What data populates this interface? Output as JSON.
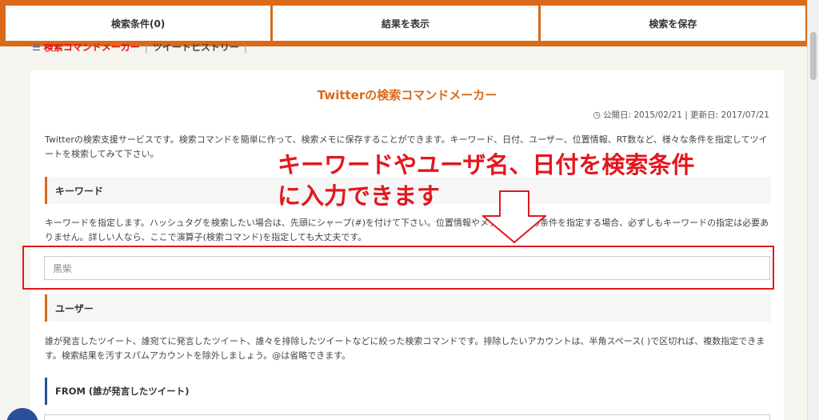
{
  "topbar": {
    "search_conditions": "検索条件(0)",
    "show_results": "結果を表示",
    "save_search": "検索を保存"
  },
  "subnav": {
    "active_tab": "検索コマンドメーカー",
    "other_tab": "ツイートヒストリー"
  },
  "page": {
    "title": "Twitterの検索コマンドメーカー",
    "dates": "公開日: 2015/02/21 | 更新日: 2017/07/21",
    "intro": "Twitterの検索支援サービスです。検索コマンドを簡単に作って、検索メモに保存することができます。キーワード、日付、ユーザー、位置情報、RT数など、様々な条件を指定してツイートを検索してみて下さい。"
  },
  "keyword_section": {
    "heading": "キーワード",
    "description": "キーワードを指定します。ハッシュタグを検索したい場合は、先頭にシャープ(#)を付けて下さい。位置情報やメディア、他の条件を指定する場合、必ずしもキーワードの指定は必要ありません。詳しい人なら、ここで演算子(検索コマンド)を指定しても大丈夫です。",
    "input_value": "黒柴"
  },
  "user_section": {
    "heading": "ユーザー",
    "description": "誰が発言したツイート、誰宛てに発言したツイート、誰々を排除したツイートなどに絞った検索コマンドです。排除したいアカウントは、半角スペース( )で区切れば、複数指定できます。検索結果を汚すスパムアカウントを除外しましょう。@は省略できます。",
    "from_heading": "FROM (誰が発言したツイート)"
  },
  "annotation": {
    "line1": "キーワードやユーザ名、日付を検索条件",
    "line2": "に入力できます"
  },
  "colors": {
    "accent_orange": "#d96a1a",
    "annotation_red": "#e3171e",
    "sub_heading_blue": "#2a4f9a"
  }
}
